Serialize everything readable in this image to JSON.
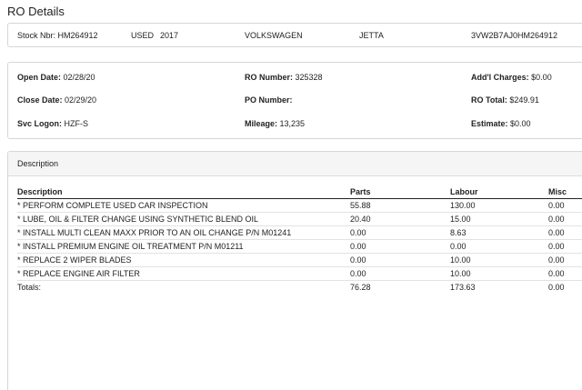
{
  "page": {
    "title": "RO Details"
  },
  "vehicle": {
    "stock": "Stock Nbr: HM264912",
    "condition": "USED",
    "year": "2017",
    "make": "VOLKSWAGEN",
    "model": "JETTA",
    "vin": "3VW2B7AJ0HM264912"
  },
  "ro": {
    "open_date_label": "Open Date:",
    "open_date": "02/28/20",
    "close_date_label": "Close Date:",
    "close_date": "02/29/20",
    "svc_logon_label": "Svc Logon:",
    "svc_logon": "HZF-S",
    "ro_number_label": "RO Number:",
    "ro_number": "325328",
    "po_number_label": "PO Number:",
    "po_number": "",
    "mileage_label": "Mileage:",
    "mileage": "13,235",
    "addl_charges_label": "Add'l Charges:",
    "addl_charges": "$0.00",
    "ro_total_label": "RO Total:",
    "ro_total": "$249.91",
    "estimate_label": "Estimate:",
    "estimate": "$0.00"
  },
  "operations": {
    "panel_title": "Description",
    "headers": {
      "description": "Description",
      "parts": "Parts",
      "labour": "Labour",
      "misc": "Misc"
    },
    "rows": [
      {
        "description": "* PERFORM COMPLETE USED CAR INSPECTION",
        "parts": "55.88",
        "labour": "130.00",
        "misc": "0.00"
      },
      {
        "description": "* LUBE, OIL & FILTER CHANGE USING SYNTHETIC BLEND OIL",
        "parts": "20.40",
        "labour": "15.00",
        "misc": "0.00"
      },
      {
        "description": "* INSTALL MULTI CLEAN MAXX PRIOR TO AN OIL CHANGE P/N M01241",
        "parts": "0.00",
        "labour": "8.63",
        "misc": "0.00"
      },
      {
        "description": "* INSTALL PREMIUM ENGINE OIL TREATMENT P/N M01211",
        "parts": "0.00",
        "labour": "0.00",
        "misc": "0.00"
      },
      {
        "description": "* REPLACE 2 WIPER BLADES",
        "parts": "0.00",
        "labour": "10.00",
        "misc": "0.00"
      },
      {
        "description": "* REPLACE ENGINE AIR FILTER",
        "parts": "0.00",
        "labour": "10.00",
        "misc": "0.00"
      }
    ],
    "totals": {
      "label": "Totals:",
      "parts": "76.28",
      "labour": "173.63",
      "misc": "0.00"
    }
  }
}
